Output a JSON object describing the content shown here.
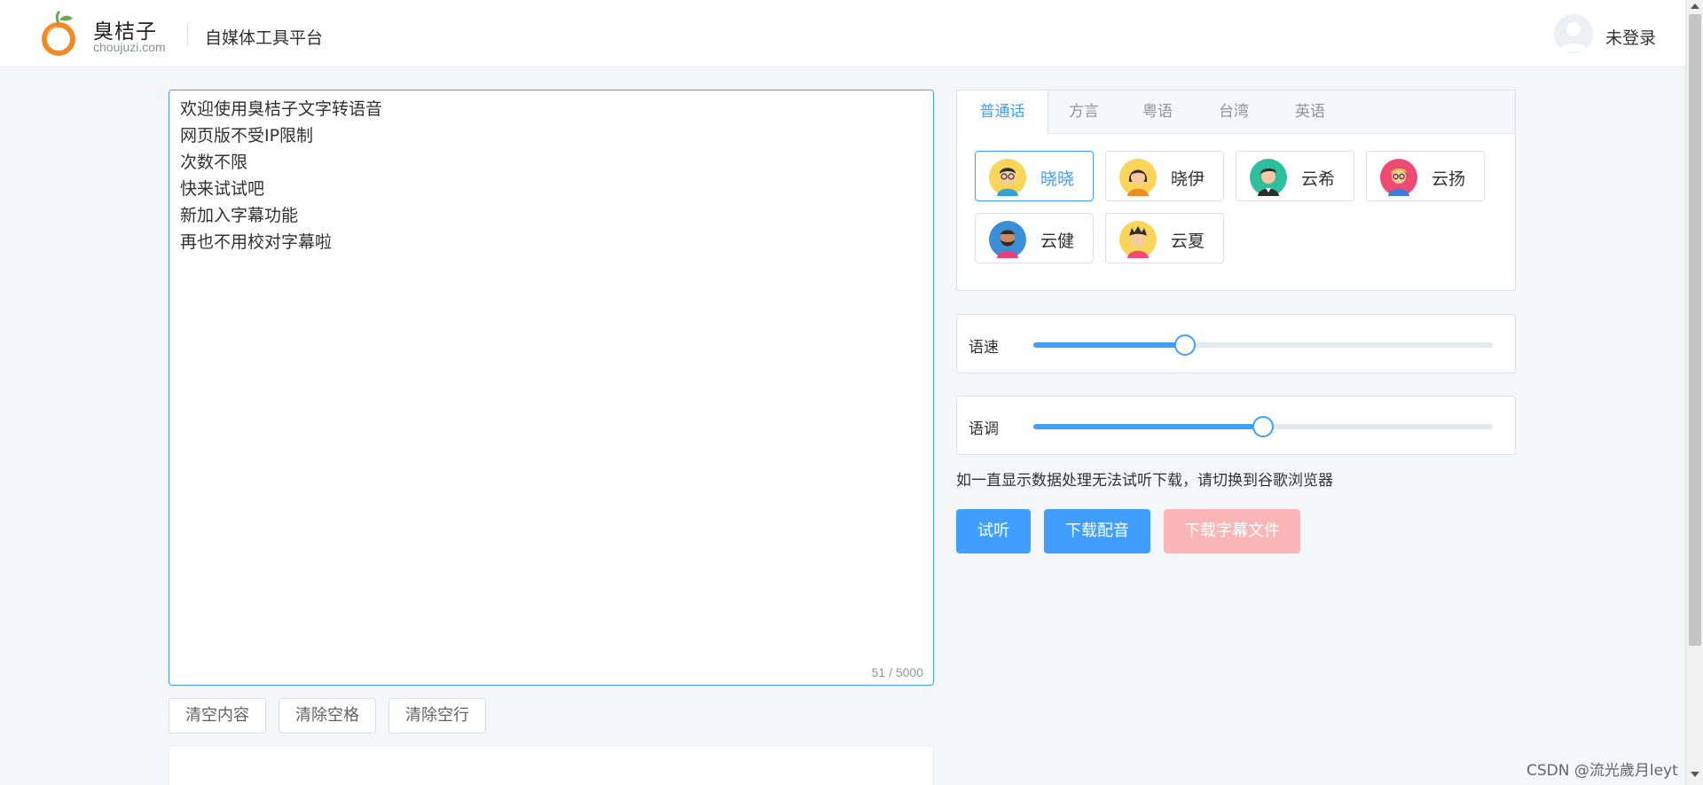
{
  "header": {
    "brand_name": "臭桔子",
    "brand_domain": "choujuzi.com",
    "platform_title": "自媒体工具平台",
    "login_label": "未登录"
  },
  "editor": {
    "text": "欢迎使用臭桔子文字转语音\n网页版不受IP限制\n次数不限\n快来试试吧\n新加入字幕功能\n再也不用校对字幕啦",
    "word_count": "51 / 5000"
  },
  "tools": {
    "clear_content": "清空内容",
    "clear_spaces": "清除空格",
    "clear_blank_lines": "清除空行"
  },
  "voice_tabs": [
    {
      "label": "普通话",
      "active": true
    },
    {
      "label": "方言",
      "active": false
    },
    {
      "label": "粤语",
      "active": false
    },
    {
      "label": "台湾",
      "active": false
    },
    {
      "label": "英语",
      "active": false
    }
  ],
  "voices": [
    {
      "name": "晓晓",
      "selected": true,
      "icon": "female-avatar-glasses-icon"
    },
    {
      "name": "晓伊",
      "selected": false,
      "icon": "female-avatar-icon"
    },
    {
      "name": "云希",
      "selected": false,
      "icon": "male-avatar-suit-icon"
    },
    {
      "name": "云扬",
      "selected": false,
      "icon": "male-avatar-glasses-icon"
    },
    {
      "name": "云健",
      "selected": false,
      "icon": "male-avatar-beard-icon"
    },
    {
      "name": "云夏",
      "selected": false,
      "icon": "boy-avatar-icon"
    }
  ],
  "speed": {
    "label": "语速",
    "value_fraction": 0.33
  },
  "pitch": {
    "label": "语调",
    "value_fraction": 0.5
  },
  "notice": "如一直显示数据处理无法试听下载，请切换到谷歌浏览器",
  "actions": {
    "preview": "试听",
    "download_audio": "下载配音",
    "download_subtitle": "下载字幕文件"
  },
  "colors": {
    "primary": "#409eff",
    "disabled_danger": "#fab6b6"
  },
  "watermark": "CSDN @流光歲月leyt"
}
